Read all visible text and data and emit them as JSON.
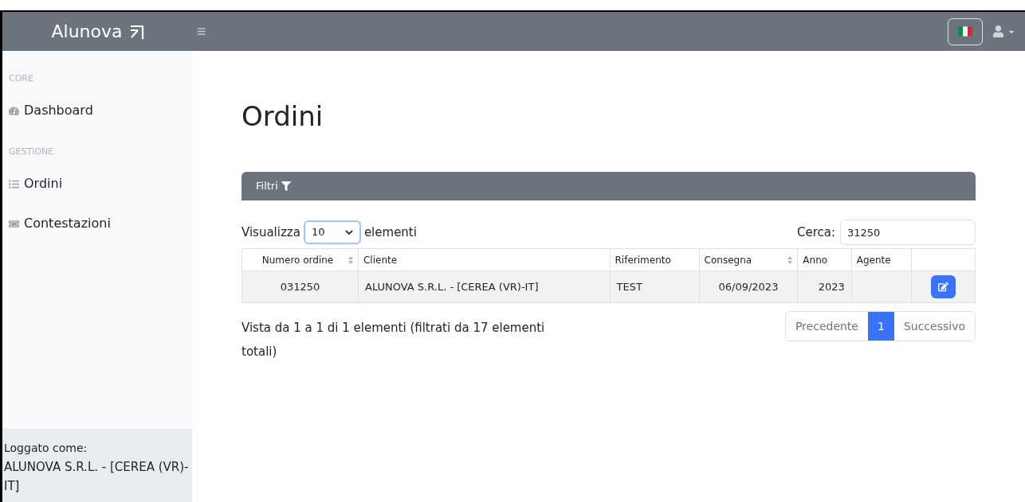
{
  "navbar": {
    "brand": "Alunova"
  },
  "sidebar": {
    "sections": [
      {
        "heading": "CORE",
        "items": [
          {
            "label": "Dashboard"
          }
        ]
      },
      {
        "heading": "GESTIONE",
        "items": [
          {
            "label": "Ordini"
          },
          {
            "label": "Contestazioni"
          }
        ]
      }
    ],
    "footer": {
      "label": "Loggato come:",
      "user": "ALUNOVA S.R.L. - [CEREA (VR)-IT]"
    }
  },
  "page": {
    "title": "Ordini",
    "filters": {
      "label": "Filtri"
    },
    "length": {
      "before": "Visualizza",
      "value": "10",
      "after": "elementi"
    },
    "search": {
      "label": "Cerca:",
      "value": "31250"
    },
    "table": {
      "columns": [
        {
          "label": "Numero ordine",
          "sortable": true
        },
        {
          "label": "Cliente",
          "sortable": false
        },
        {
          "label": "Riferimento",
          "sortable": false
        },
        {
          "label": "Consegna",
          "sortable": true
        },
        {
          "label": "Anno",
          "sortable": false
        },
        {
          "label": "Agente",
          "sortable": false
        }
      ],
      "rows": [
        {
          "cells": [
            "031250",
            "ALUNOVA S.R.L. - [CEREA (VR)-IT]",
            "TEST",
            "06/09/2023",
            "2023",
            ""
          ]
        }
      ]
    },
    "info": "Vista da 1 a 1 di 1 elementi (filtrati da 17 elementi totali)",
    "pagination": [
      {
        "label": "Precedente",
        "selected": false
      },
      {
        "label": "1",
        "selected": true
      },
      {
        "label": "Successivo",
        "selected": false
      }
    ]
  }
}
